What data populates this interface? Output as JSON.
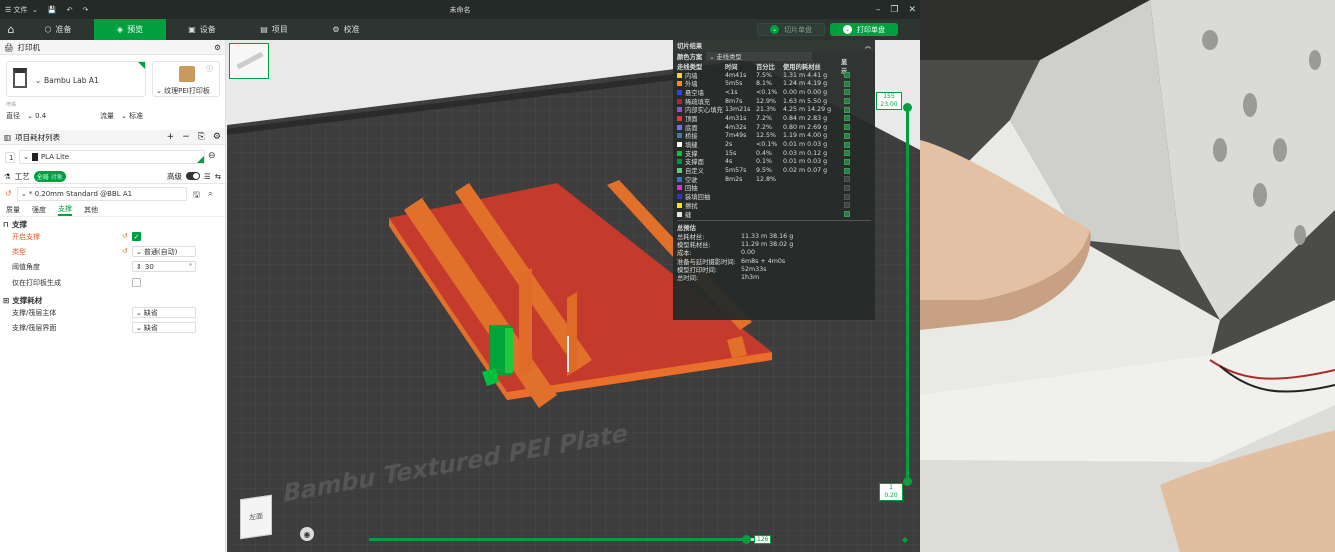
{
  "titlebar": {
    "menu_label": "文件",
    "doc_title": "未命名"
  },
  "tabs": [
    {
      "label": "准备"
    },
    {
      "label": "预览"
    },
    {
      "label": "设备"
    },
    {
      "label": "项目"
    },
    {
      "label": "校准"
    }
  ],
  "actions": {
    "slice_plate": "切片单盘",
    "print_plate": "打印单盘"
  },
  "printer": {
    "section_title": "打印机",
    "name": "Bambu Lab A1",
    "plate_name": "纹理PEI打印板",
    "nozzle_label": "直径",
    "nozzle_value": "0.4",
    "flow_label": "流量",
    "flow_value": "标准",
    "small_label": "喷嘴"
  },
  "filament": {
    "section_title": "项目耗材列表",
    "index": "1",
    "name": "PLA Lite"
  },
  "process": {
    "section_title": "工艺",
    "toggle_all": "全局",
    "toggle_obj": "对象",
    "advanced_label": "高级",
    "preset": "* 0.20mm Standard @BBL A1",
    "tabs": [
      "质量",
      "强度",
      "支撑",
      "其他"
    ]
  },
  "support": {
    "group_title": "支撑",
    "rows": [
      {
        "label": "开启支撑",
        "kind": "check",
        "checked": true
      },
      {
        "label": "类型",
        "kind": "select",
        "value": "普通(自动)"
      },
      {
        "label": "阈值角度",
        "kind": "num",
        "value": "30"
      },
      {
        "label": "仅在打印板生成",
        "kind": "check",
        "checked": false
      }
    ]
  },
  "support_filament": {
    "group_title": "支撑耗材",
    "rows": [
      {
        "label": "支撑/筏层主体",
        "value": "缺省"
      },
      {
        "label": "支撑/筏层界面",
        "value": "缺省"
      }
    ]
  },
  "stats": {
    "title": "切片结果",
    "scheme_label": "颜色方案",
    "scheme_value": "走线类型",
    "headers": [
      "走线类型",
      "时间",
      "百分比",
      "使用的耗材丝",
      "显示"
    ],
    "rows": [
      {
        "name": "内墙",
        "color": "#ffd23c",
        "time": "4m41s",
        "pct": "7.5%",
        "usage": "1.31 m 4.41 g",
        "show": true
      },
      {
        "name": "外墙",
        "color": "#ff8c1e",
        "time": "5m5s",
        "pct": "8.1%",
        "usage": "1.24 m 4.19 g",
        "show": true
      },
      {
        "name": "悬空墙",
        "color": "#2840ff",
        "time": "<1s",
        "pct": "<0.1%",
        "usage": "0.00 m 0.00 g",
        "show": true
      },
      {
        "name": "稀疏填充",
        "color": "#b02828",
        "time": "8m7s",
        "pct": "12.9%",
        "usage": "1.63 m 5.50 g",
        "show": true
      },
      {
        "name": "内部实心填充",
        "color": "#9650d2",
        "time": "13m21s",
        "pct": "21.3%",
        "usage": "4.25 m 14.29 g",
        "show": true
      },
      {
        "name": "顶面",
        "color": "#f03232",
        "time": "4m31s",
        "pct": "7.2%",
        "usage": "0.84 m 2.83 g",
        "show": true
      },
      {
        "name": "底面",
        "color": "#6478f0",
        "time": "4m32s",
        "pct": "7.2%",
        "usage": "0.80 m 2.69 g",
        "show": true
      },
      {
        "name": "桥接",
        "color": "#4b78a0",
        "time": "7m49s",
        "pct": "12.5%",
        "usage": "1.19 m 4.00 g",
        "show": true
      },
      {
        "name": "填缝",
        "color": "#ffffff",
        "time": "2s",
        "pct": "<0.1%",
        "usage": "0.01 m 0.03 g",
        "show": true
      },
      {
        "name": "支撑",
        "color": "#00c83c",
        "time": "15s",
        "pct": "0.4%",
        "usage": "0.03 m 0.12 g",
        "show": true
      },
      {
        "name": "支撑面",
        "color": "#00963c",
        "time": "4s",
        "pct": "0.1%",
        "usage": "0.01 m 0.03 g",
        "show": true
      },
      {
        "name": "自定义",
        "color": "#5ad278",
        "time": "5m57s",
        "pct": "9.5%",
        "usage": "0.02 m 0.07 g",
        "show": true
      },
      {
        "name": "空驶",
        "color": "#3a6ec8",
        "time": "8m2s",
        "pct": "12.8%",
        "usage": "",
        "show": false
      },
      {
        "name": "回抽",
        "color": "#d232d2",
        "time": "",
        "pct": "",
        "usage": "",
        "show": false
      },
      {
        "name": "装填回抽",
        "color": "#3232d2",
        "time": "",
        "pct": "",
        "usage": "",
        "show": false
      },
      {
        "name": "擦拭",
        "color": "#ffe600",
        "time": "",
        "pct": "",
        "usage": "",
        "show": false
      },
      {
        "name": "缝",
        "color": "#e6e6e6",
        "time": "",
        "pct": "",
        "usage": "",
        "show": true
      }
    ],
    "summary_title": "总预估",
    "summary": [
      {
        "label": "总耗材丝:",
        "value": "11.33 m   38.16 g"
      },
      {
        "label": "模型耗材丝:",
        "value": "11.29 m   38.02 g"
      },
      {
        "label": "成本:",
        "value": "0.00"
      },
      {
        "label": "准备与延时摄影时间:",
        "value": "6m8s + 4m0s"
      },
      {
        "label": "模型打印时间:",
        "value": "52m33s"
      },
      {
        "label": "总时间:",
        "value": "1h3m"
      }
    ]
  },
  "layer_slider": {
    "top_layer": "155",
    "top_height": "23.00",
    "bottom_layer": "1",
    "bottom_height": "0.20"
  },
  "move_slider": {
    "value": "126",
    "fraction": 0.98
  },
  "plate_label": "Bambu Textured PEI Plate",
  "view_cube": {
    "face": "左面"
  },
  "colors": {
    "accent": "#00a040",
    "titlebar": "#232a27",
    "bed": "#3d3d3d",
    "model_top": "#c43a2c",
    "model_side": "#e06a28"
  },
  "icons": {
    "home": "home-icon",
    "gear": "gear-icon",
    "undo": "undo-icon",
    "redo": "redo-icon",
    "save": "save-icon"
  }
}
